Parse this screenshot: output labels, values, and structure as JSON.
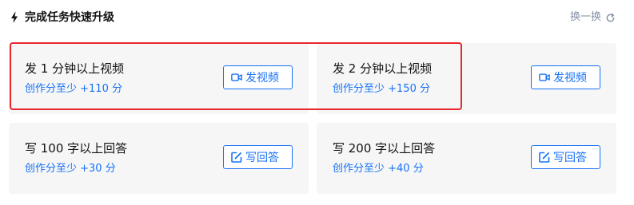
{
  "header": {
    "title": "完成任务快速升级",
    "refresh_label": "换一换"
  },
  "tasks": [
    {
      "title": "发 1 分钟以上视频",
      "reward": "创作分至少 +110 分",
      "button": "发视频",
      "icon": "video-icon"
    },
    {
      "title": "发 2 分钟以上视频",
      "reward": "创作分至少 +150 分",
      "button": "发视频",
      "icon": "video-icon"
    },
    {
      "title": "写 100 字以上回答",
      "reward": "创作分至少 +30 分",
      "button": "写回答",
      "icon": "edit-icon"
    },
    {
      "title": "写 200 字以上回答",
      "reward": "创作分至少 +40 分",
      "button": "写回答",
      "icon": "edit-icon"
    }
  ],
  "colors": {
    "accent": "#1772f6",
    "highlight": "#e8262b",
    "card_bg": "#f6f6f6",
    "muted": "#8590a6"
  }
}
